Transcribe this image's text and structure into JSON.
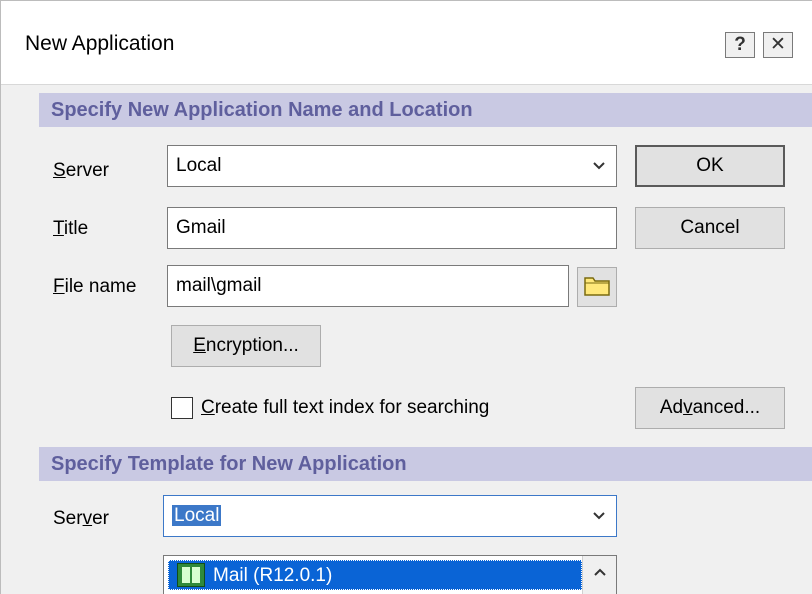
{
  "window": {
    "title": "New Application",
    "help_label": "?",
    "close_label": "✕"
  },
  "section1": {
    "header": "Specify New Application Name and Location",
    "server_label_pre": "",
    "server_label_u": "S",
    "server_label_post": "erver",
    "server_value": "Local",
    "title_label_u": "T",
    "title_label_post": "itle",
    "title_value": "Gmail",
    "filename_label_u": "F",
    "filename_label_post": "ile name",
    "filename_value": "mail\\gmail",
    "encryption_u": "E",
    "encryption_post": "ncryption...",
    "fulltext_u": "C",
    "fulltext_post": "reate full text index for searching",
    "fulltext_checked": false
  },
  "buttons": {
    "ok": "OK",
    "cancel": "Cancel",
    "advanced_pre": "Ad",
    "advanced_u": "v",
    "advanced_post": "anced..."
  },
  "section2": {
    "header": "Specify Template for New Application",
    "server_label_pre": "Ser",
    "server_label_u": "v",
    "server_label_post": "er",
    "server_value": "Local",
    "template_items": [
      {
        "label": "Mail (R12.0.1)",
        "selected": true
      }
    ]
  },
  "colors": {
    "section_bg": "#c9c9e3",
    "section_text": "#5f5f9d",
    "selection": "#0a64d6"
  }
}
